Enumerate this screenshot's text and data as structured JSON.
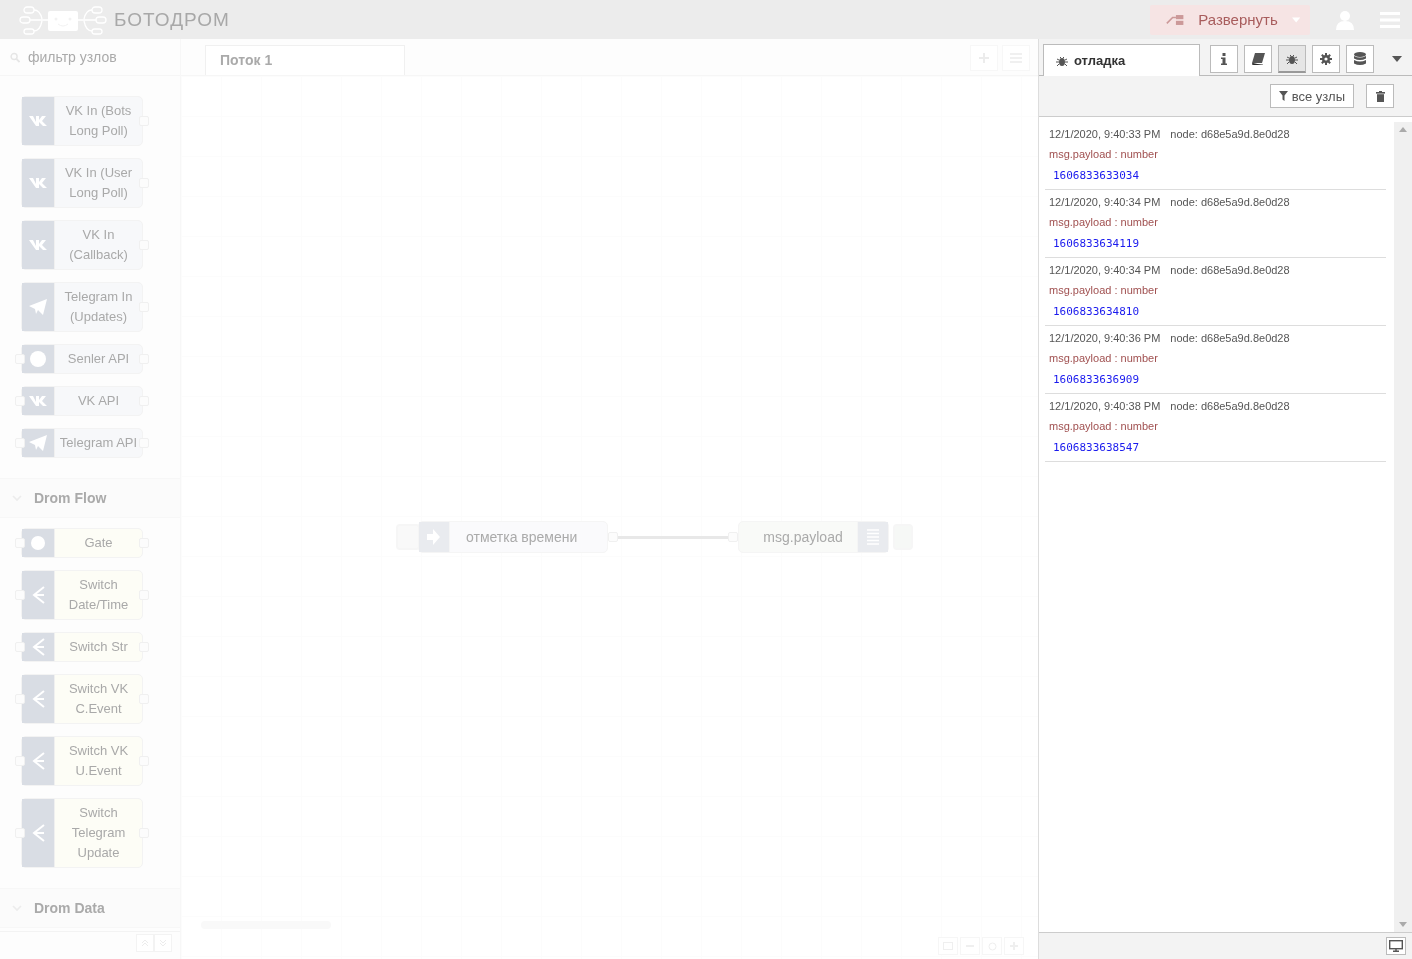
{
  "header": {
    "brand": "БОТОДРОМ",
    "deploy_button": "Развернуть"
  },
  "palette": {
    "filter_placeholder": "фильтр узлов",
    "nodes": [
      {
        "label": "VK In (Bots Long Poll)",
        "kind": "vk",
        "color": "#f7f8fa",
        "input": false,
        "output": true
      },
      {
        "label": "VK In (User Long Poll)",
        "kind": "vk",
        "color": "#f7f8fa",
        "input": false,
        "output": true
      },
      {
        "label": "VK In (Callback)",
        "kind": "vk",
        "color": "#f7f8fa",
        "input": false,
        "output": true
      },
      {
        "label": "Telegram In (Updates)",
        "kind": "telegram",
        "color": "#f7f8fa",
        "input": false,
        "output": true
      },
      {
        "label": "Senler API",
        "kind": "senler",
        "color": "#f7f8fa",
        "input": true,
        "output": true
      },
      {
        "label": "VK API",
        "kind": "vk",
        "color": "#f7f8fa",
        "input": true,
        "output": true
      },
      {
        "label": "Telegram API",
        "kind": "telegram",
        "color": "#f7f8fa",
        "input": true,
        "output": true
      }
    ],
    "categories": [
      {
        "label": "Drom Flow",
        "expanded": true,
        "nodes": [
          {
            "label": "Gate",
            "kind": "gate",
            "color": "#fdfdf6",
            "input": true,
            "output": true
          },
          {
            "label": "Switch Date/Time",
            "kind": "switch",
            "color": "#fdfdf6",
            "input": true,
            "output": true
          },
          {
            "label": "Switch Str",
            "kind": "switch",
            "color": "#fdfdf6",
            "input": true,
            "output": true
          },
          {
            "label": "Switch VK C.Event",
            "kind": "switch",
            "color": "#fdfdf6",
            "input": true,
            "output": true
          },
          {
            "label": "Switch VK U.Event",
            "kind": "switch",
            "color": "#fdfdf6",
            "input": true,
            "output": true
          },
          {
            "label": "Switch Telegram Update",
            "kind": "switch",
            "color": "#fdfdf6",
            "input": true,
            "output": true
          }
        ]
      },
      {
        "label": "Drom Data",
        "expanded": true
      }
    ]
  },
  "workspace": {
    "tabs": [
      {
        "label": "Поток 1",
        "selected": true
      }
    ],
    "flow_nodes": [
      {
        "kind": "inject",
        "label": "отметка времени"
      },
      {
        "kind": "debug",
        "label": "msg.payload"
      }
    ]
  },
  "sidebar": {
    "tabs": [
      {
        "label": "отладка",
        "selected": true
      }
    ],
    "tools": [
      {
        "kind": "info",
        "selected": false
      },
      {
        "kind": "book",
        "selected": false
      },
      {
        "kind": "bug",
        "selected": true
      },
      {
        "kind": "gear",
        "selected": false
      },
      {
        "kind": "database",
        "selected": false
      }
    ],
    "filter_button": "все узлы",
    "messages": [
      {
        "time": "12/1/2020, 9:40:33 PM",
        "node": "node: d68e5a9d.8e0d28",
        "meta": "msg.payload : number",
        "value": "1606833633034"
      },
      {
        "time": "12/1/2020, 9:40:34 PM",
        "node": "node: d68e5a9d.8e0d28",
        "meta": "msg.payload : number",
        "value": "1606833634119"
      },
      {
        "time": "12/1/2020, 9:40:34 PM",
        "node": "node: d68e5a9d.8e0d28",
        "meta": "msg.payload : number",
        "value": "1606833634810"
      },
      {
        "time": "12/1/2020, 9:40:36 PM",
        "node": "node: d68e5a9d.8e0d28",
        "meta": "msg.payload : number",
        "value": "1606833636909"
      },
      {
        "time": "12/1/2020, 9:40:38 PM",
        "node": "node: d68e5a9d.8e0d28",
        "meta": "msg.payload : number",
        "value": "1606833638547"
      }
    ]
  }
}
